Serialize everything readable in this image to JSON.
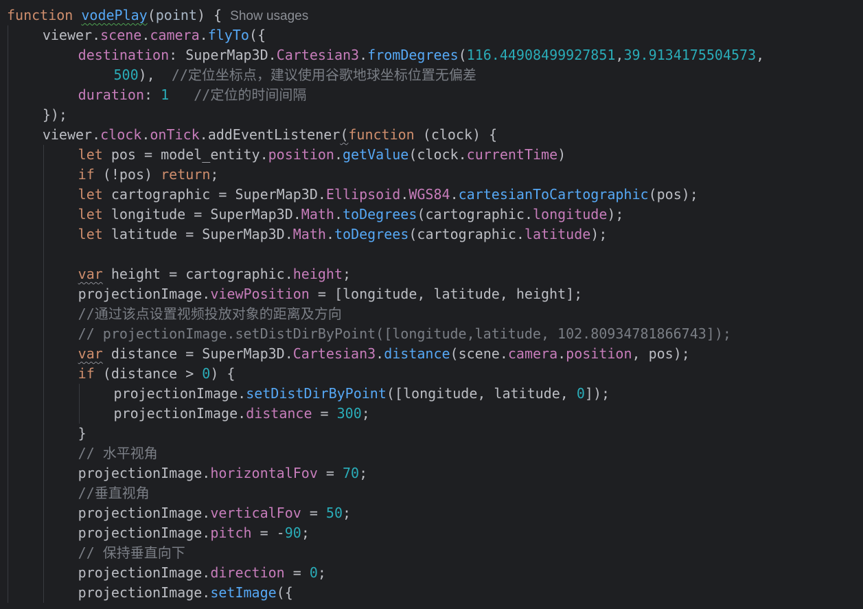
{
  "editor": {
    "usage_hint": "Show usages",
    "lines": [
      {
        "tokens": [
          [
            "kw",
            "function "
          ],
          [
            "fn",
            "vodePlay"
          ],
          [
            "pun",
            "("
          ],
          [
            "param",
            "point"
          ],
          [
            "pun",
            ") { "
          ]
        ],
        "hint": true
      },
      {
        "tokens": [
          [
            "id",
            "viewer"
          ],
          [
            "pun",
            "."
          ],
          [
            "prop",
            "scene"
          ],
          [
            "pun",
            "."
          ],
          [
            "prop",
            "camera"
          ],
          [
            "pun",
            "."
          ],
          [
            "fn",
            "flyTo"
          ],
          [
            "pun",
            "({"
          ]
        ]
      },
      {
        "tokens": [
          [
            "prop",
            "destination"
          ],
          [
            "pun",
            ": "
          ],
          [
            "id",
            "SuperMap3D"
          ],
          [
            "pun",
            "."
          ],
          [
            "cls",
            "Cartesian3"
          ],
          [
            "pun",
            "."
          ],
          [
            "fn",
            "fromDegrees"
          ],
          [
            "pun",
            "("
          ],
          [
            "num",
            "116.44908499927851"
          ],
          [
            "pun",
            ","
          ],
          [
            "num",
            "39.9134175504573"
          ],
          [
            "pun",
            ","
          ]
        ]
      },
      {
        "tokens": [
          [
            "num",
            "500"
          ],
          [
            "pun",
            "),  "
          ],
          [
            "cmt",
            "//定位坐标点，建议使用谷歌地球坐标位置无偏差"
          ]
        ]
      },
      {
        "tokens": [
          [
            "prop",
            "duration"
          ],
          [
            "pun",
            ": "
          ],
          [
            "num",
            "1"
          ],
          [
            "pun",
            "   "
          ],
          [
            "cmt",
            "//定位的时间间隔"
          ]
        ]
      },
      {
        "tokens": [
          [
            "pun",
            "});"
          ]
        ]
      },
      {
        "tokens": [
          [
            "id",
            "viewer"
          ],
          [
            "pun",
            "."
          ],
          [
            "prop",
            "clock"
          ],
          [
            "pun",
            "."
          ],
          [
            "prop",
            "onTick"
          ],
          [
            "pun",
            "."
          ],
          [
            "id",
            "addEventListener"
          ],
          [
            "pun",
            "("
          ],
          [
            "kw",
            "function "
          ],
          [
            "pun",
            "("
          ],
          [
            "id",
            "clock"
          ],
          [
            "pun",
            ") {"
          ]
        ]
      },
      {
        "tokens": [
          [
            "kw",
            "let "
          ],
          [
            "id",
            "pos = model_entity"
          ],
          [
            "pun",
            "."
          ],
          [
            "prop",
            "position"
          ],
          [
            "pun",
            "."
          ],
          [
            "fn",
            "getValue"
          ],
          [
            "pun",
            "("
          ],
          [
            "id",
            "clock"
          ],
          [
            "pun",
            "."
          ],
          [
            "prop",
            "currentTime"
          ],
          [
            "pun",
            ")"
          ]
        ]
      },
      {
        "tokens": [
          [
            "kw",
            "if "
          ],
          [
            "pun",
            "(!"
          ],
          [
            "id",
            "pos"
          ],
          [
            "pun",
            ") "
          ],
          [
            "kw",
            "return"
          ],
          [
            "pun",
            ";"
          ]
        ]
      },
      {
        "tokens": [
          [
            "kw",
            "let "
          ],
          [
            "id",
            "cartographic = SuperMap3D"
          ],
          [
            "pun",
            "."
          ],
          [
            "cls",
            "Ellipsoid"
          ],
          [
            "pun",
            "."
          ],
          [
            "cls",
            "WGS84"
          ],
          [
            "pun",
            "."
          ],
          [
            "fn",
            "cartesianToCartographic"
          ],
          [
            "pun",
            "("
          ],
          [
            "id",
            "pos"
          ],
          [
            "pun",
            ");"
          ]
        ]
      },
      {
        "tokens": [
          [
            "kw",
            "let "
          ],
          [
            "id",
            "longitude = SuperMap3D"
          ],
          [
            "pun",
            "."
          ],
          [
            "cls",
            "Math"
          ],
          [
            "pun",
            "."
          ],
          [
            "fn",
            "toDegrees"
          ],
          [
            "pun",
            "("
          ],
          [
            "id",
            "cartographic"
          ],
          [
            "pun",
            "."
          ],
          [
            "prop",
            "longitude"
          ],
          [
            "pun",
            ");"
          ]
        ]
      },
      {
        "tokens": [
          [
            "kw",
            "let "
          ],
          [
            "id",
            "latitude = SuperMap3D"
          ],
          [
            "pun",
            "."
          ],
          [
            "cls",
            "Math"
          ],
          [
            "pun",
            "."
          ],
          [
            "fn",
            "toDegrees"
          ],
          [
            "pun",
            "("
          ],
          [
            "id",
            "cartographic"
          ],
          [
            "pun",
            "."
          ],
          [
            "prop",
            "latitude"
          ],
          [
            "pun",
            ");"
          ]
        ]
      },
      {
        "tokens": []
      },
      {
        "tokens": [
          [
            "kw",
            "var"
          ],
          [
            "id",
            " height = cartographic"
          ],
          [
            "pun",
            "."
          ],
          [
            "prop",
            "height"
          ],
          [
            "pun",
            ";"
          ]
        ]
      },
      {
        "tokens": [
          [
            "id",
            "projectionImage"
          ],
          [
            "pun",
            "."
          ],
          [
            "prop",
            "viewPosition"
          ],
          [
            "pun",
            " = ["
          ],
          [
            "id",
            "longitude, latitude, height"
          ],
          [
            "pun",
            "];"
          ]
        ]
      },
      {
        "tokens": [
          [
            "cmt",
            "//通过该点设置视频投放对象的距离及方向"
          ]
        ]
      },
      {
        "tokens": [
          [
            "cmt",
            "// projectionImage.setDistDirByPoint([longitude,latitude, 102.80934781866743]);"
          ]
        ]
      },
      {
        "tokens": [
          [
            "kw",
            "var"
          ],
          [
            "id",
            " distance = SuperMap3D"
          ],
          [
            "pun",
            "."
          ],
          [
            "cls",
            "Cartesian3"
          ],
          [
            "pun",
            "."
          ],
          [
            "fn",
            "distance"
          ],
          [
            "pun",
            "("
          ],
          [
            "id",
            "scene"
          ],
          [
            "pun",
            "."
          ],
          [
            "prop",
            "camera"
          ],
          [
            "pun",
            "."
          ],
          [
            "prop",
            "position"
          ],
          [
            "pun",
            ", "
          ],
          [
            "id",
            "pos"
          ],
          [
            "pun",
            ");"
          ]
        ]
      },
      {
        "tokens": [
          [
            "kw",
            "if "
          ],
          [
            "pun",
            "("
          ],
          [
            "id",
            "distance > "
          ],
          [
            "num",
            "0"
          ],
          [
            "pun",
            ") {"
          ]
        ]
      },
      {
        "tokens": [
          [
            "id",
            "projectionImage"
          ],
          [
            "pun",
            "."
          ],
          [
            "fn",
            "setDistDirByPoint"
          ],
          [
            "pun",
            "(["
          ],
          [
            "id",
            "longitude, latitude, "
          ],
          [
            "num",
            "0"
          ],
          [
            "pun",
            "]);"
          ]
        ]
      },
      {
        "tokens": [
          [
            "id",
            "projectionImage"
          ],
          [
            "pun",
            "."
          ],
          [
            "prop",
            "distance"
          ],
          [
            "pun",
            " = "
          ],
          [
            "num",
            "300"
          ],
          [
            "pun",
            ";"
          ]
        ]
      },
      {
        "tokens": [
          [
            "pun",
            "}"
          ]
        ]
      },
      {
        "tokens": [
          [
            "cmt",
            "// 水平视角"
          ]
        ]
      },
      {
        "tokens": [
          [
            "id",
            "projectionImage"
          ],
          [
            "pun",
            "."
          ],
          [
            "prop",
            "horizontalFov"
          ],
          [
            "pun",
            " = "
          ],
          [
            "num",
            "70"
          ],
          [
            "pun",
            ";"
          ]
        ]
      },
      {
        "tokens": [
          [
            "cmt",
            "//垂直视角"
          ]
        ]
      },
      {
        "tokens": [
          [
            "id",
            "projectionImage"
          ],
          [
            "pun",
            "."
          ],
          [
            "prop",
            "verticalFov"
          ],
          [
            "pun",
            " = "
          ],
          [
            "num",
            "50"
          ],
          [
            "pun",
            ";"
          ]
        ]
      },
      {
        "tokens": [
          [
            "id",
            "projectionImage"
          ],
          [
            "pun",
            "."
          ],
          [
            "prop",
            "pitch"
          ],
          [
            "pun",
            " = -"
          ],
          [
            "num",
            "90"
          ],
          [
            "pun",
            ";"
          ]
        ]
      },
      {
        "tokens": [
          [
            "cmt",
            "// 保持垂直向下"
          ]
        ]
      },
      {
        "tokens": [
          [
            "id",
            "projectionImage"
          ],
          [
            "pun",
            "."
          ],
          [
            "prop",
            "direction"
          ],
          [
            "pun",
            " = "
          ],
          [
            "num",
            "0"
          ],
          [
            "pun",
            ";"
          ]
        ]
      },
      {
        "tokens": [
          [
            "id",
            "projectionImage"
          ],
          [
            "pun",
            "."
          ],
          [
            "fn",
            "setImage"
          ],
          [
            "pun",
            "({"
          ]
        ]
      }
    ]
  },
  "colors": {
    "background": "#1e1f22",
    "keyword": "#cf8e6d",
    "function": "#56a8f5",
    "property": "#c77dbb",
    "number": "#2aacb8",
    "comment": "#7a7e85",
    "text": "#bcbec4"
  }
}
